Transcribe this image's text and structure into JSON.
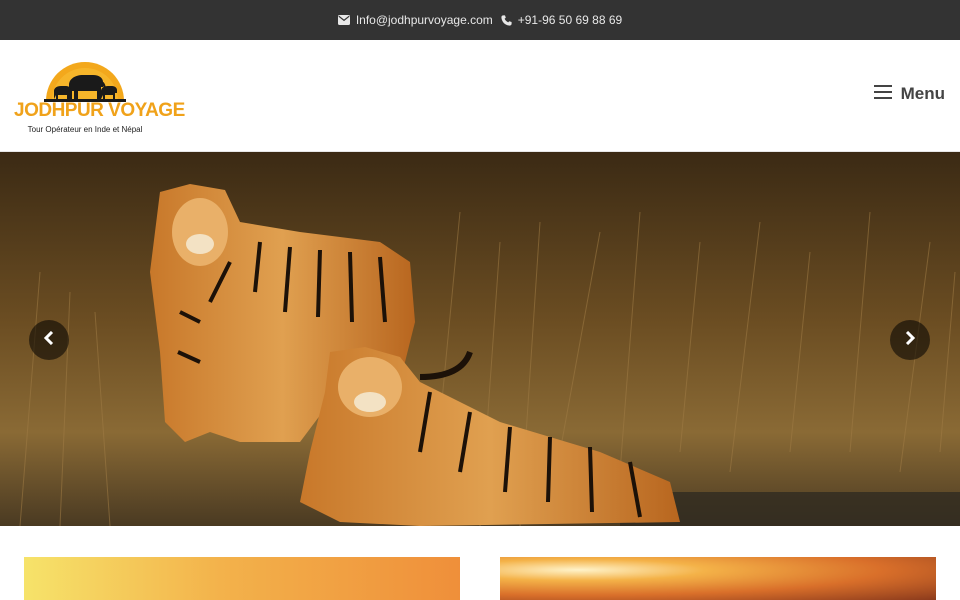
{
  "topbar": {
    "email": "Info@jodhpurvoyage.com",
    "phone": "+91-96 50 69 88 69"
  },
  "logo": {
    "name": "JODHPUR VOYAGE",
    "tagline": "Tour Opérateur en Inde et Népal"
  },
  "header": {
    "menu_label": "Menu"
  },
  "hero": {
    "image_subject": "two tigers in dry grass"
  },
  "colors": {
    "topbar_bg": "#333333",
    "brand_orange": "#f0a21a",
    "menu_text": "#444444"
  }
}
